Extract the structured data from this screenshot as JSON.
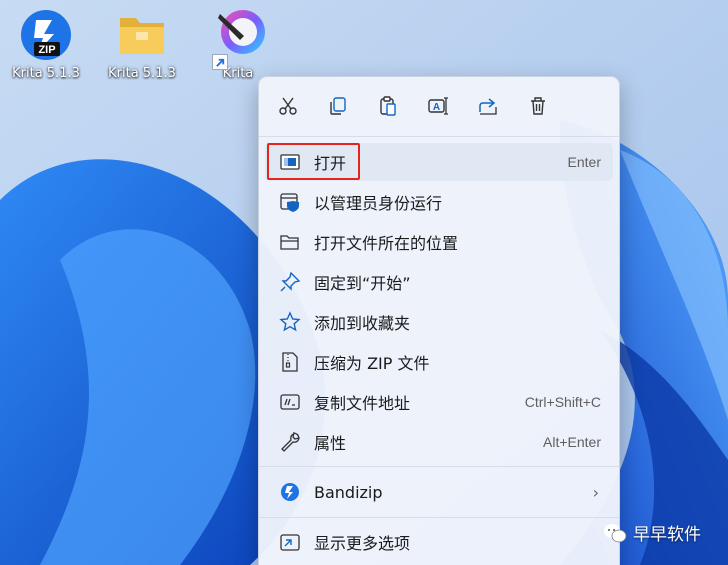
{
  "desktop": {
    "icons": [
      {
        "label": "Krita 5.1.3",
        "type": "zip",
        "badge": "ZIP"
      },
      {
        "label": "Krita 5.1.3",
        "type": "folder"
      },
      {
        "label": "Krita",
        "type": "krita-shortcut"
      }
    ]
  },
  "context_menu": {
    "toolbar": [
      {
        "icon": "scissors-icon",
        "action": "cut"
      },
      {
        "icon": "copy-icon",
        "action": "copy"
      },
      {
        "icon": "paste-icon",
        "action": "paste"
      },
      {
        "icon": "rename-icon",
        "action": "rename"
      },
      {
        "icon": "share-icon",
        "action": "share"
      },
      {
        "icon": "trash-icon",
        "action": "delete"
      }
    ],
    "items": [
      {
        "label": "打开",
        "shortcut": "Enter",
        "icon": "open-window-icon",
        "highlighted": true
      },
      {
        "label": "以管理员身份运行",
        "shortcut": "",
        "icon": "shield-run-icon"
      },
      {
        "label": "打开文件所在的位置",
        "shortcut": "",
        "icon": "folder-icon"
      },
      {
        "label": "固定到“开始”",
        "shortcut": "",
        "icon": "pin-icon"
      },
      {
        "label": "添加到收藏夹",
        "shortcut": "",
        "icon": "star-icon"
      },
      {
        "label": "压缩为 ZIP 文件",
        "shortcut": "",
        "icon": "zip-file-icon"
      },
      {
        "label": "复制文件地址",
        "shortcut": "Ctrl+Shift+C",
        "icon": "copy-path-icon"
      },
      {
        "label": "属性",
        "shortcut": "Alt+Enter",
        "icon": "wrench-icon"
      },
      {
        "label": "Bandizip",
        "icon": "bandizip-icon",
        "submenu": "›"
      },
      {
        "label": "显示更多选项",
        "shortcut": "",
        "icon": "more-options-icon"
      }
    ]
  },
  "watermark": {
    "text": "早早软件"
  },
  "colors": {
    "accent": "#0067c0",
    "highlight_border": "#e3261d",
    "wallpaper_blue": "#1b5fd6"
  }
}
